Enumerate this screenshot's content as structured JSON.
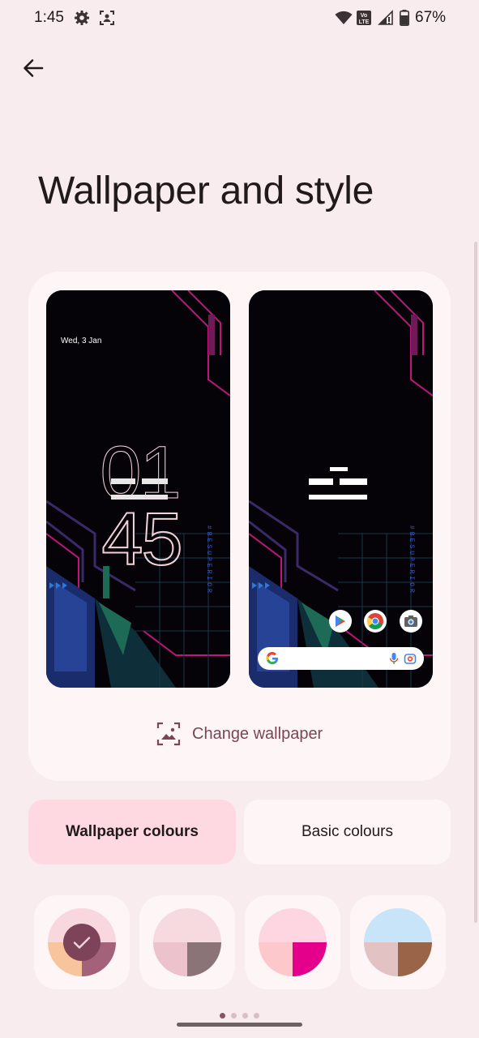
{
  "status_bar": {
    "time": "1:45",
    "network_label": "Vo LTE",
    "battery": "67%"
  },
  "page": {
    "title": "Wallpaper and style"
  },
  "preview": {
    "lock_date": "Wed, 3 Jan",
    "clock_hours": "01",
    "clock_minutes": "45",
    "change_wallpaper_label": "Change wallpaper",
    "wallpaper_text": "#BESUPERIOR"
  },
  "tabs": [
    {
      "label": "Wallpaper colours",
      "selected": true
    },
    {
      "label": "Basic colours",
      "selected": false
    }
  ],
  "swatches": [
    {
      "name": "swatch-1",
      "selected": true,
      "top": "#f9d7de",
      "bottom_left": "#f8c49b",
      "bottom_right": "#a3627a"
    },
    {
      "name": "swatch-2",
      "selected": false,
      "top": "#f7d9e0",
      "bottom_left": "#ecc3cd",
      "bottom_right": "#8a7478"
    },
    {
      "name": "swatch-3",
      "selected": false,
      "top": "#fdd6e1",
      "bottom_left": "#fdc8cc",
      "bottom_right": "#e4008a"
    },
    {
      "name": "swatch-4",
      "selected": false,
      "top": "#c7e4f8",
      "bottom_left": "#e2c2c2",
      "bottom_right": "#9a6449"
    }
  ],
  "pager": {
    "pages": 4,
    "current": 1
  },
  "colors": {
    "accent": "#7a4656",
    "background": "#f8ecee",
    "card": "#fdf5f6",
    "selected_tab": "#ffd9e2"
  }
}
